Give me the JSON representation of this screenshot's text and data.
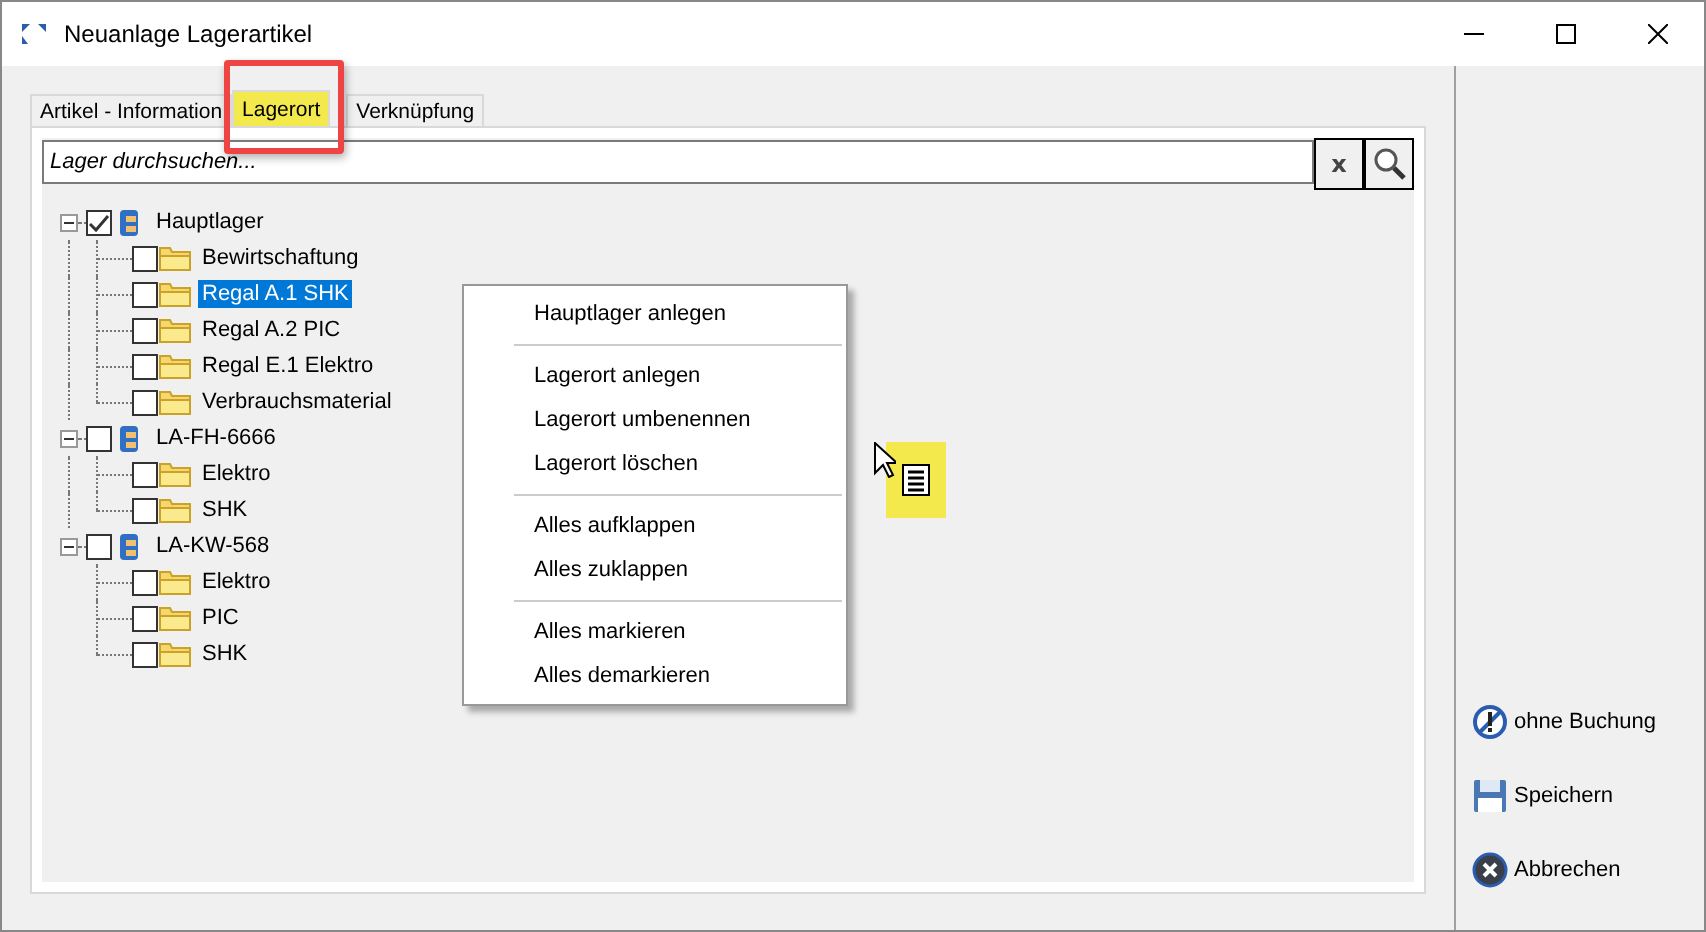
{
  "window": {
    "title": "Neuanlage Lagerartikel"
  },
  "tabs": [
    {
      "label": "Artikel - Information",
      "selected": false
    },
    {
      "label": "Lagerort",
      "selected": true,
      "highlighted": true
    },
    {
      "label": "Verknüpfung",
      "selected": false
    }
  ],
  "search": {
    "placeholder": "Lager durchsuchen...",
    "clear_label": "x"
  },
  "tree": [
    {
      "label": "Hauptlager",
      "checked": true,
      "selected": false,
      "expanded": true,
      "children": [
        {
          "label": "Bewirtschaftung",
          "checked": false,
          "selected": false
        },
        {
          "label": "Regal A.1 SHK",
          "checked": false,
          "selected": true
        },
        {
          "label": "Regal A.2 PIC",
          "checked": false,
          "selected": false
        },
        {
          "label": "Regal E.1 Elektro",
          "checked": false,
          "selected": false
        },
        {
          "label": "Verbrauchsmaterial",
          "checked": false,
          "selected": false
        }
      ]
    },
    {
      "label": "LA-FH-6666",
      "checked": false,
      "selected": false,
      "expanded": true,
      "children": [
        {
          "label": "Elektro",
          "checked": false,
          "selected": false
        },
        {
          "label": "SHK",
          "checked": false,
          "selected": false
        }
      ]
    },
    {
      "label": "LA-KW-568",
      "checked": false,
      "selected": false,
      "expanded": true,
      "children": [
        {
          "label": "Elektro",
          "checked": false,
          "selected": false
        },
        {
          "label": "PIC",
          "checked": false,
          "selected": false
        },
        {
          "label": "SHK",
          "checked": false,
          "selected": false
        }
      ]
    }
  ],
  "context_menu": [
    [
      "Hauptlager anlegen"
    ],
    [
      "Lagerort anlegen",
      "Lagerort umbenennen",
      "Lagerort löschen"
    ],
    [
      "Alles aufklappen",
      "Alles zuklappen"
    ],
    [
      "Alles markieren",
      "Alles demarkieren"
    ]
  ],
  "actions": [
    {
      "kind": "nobook",
      "label": "ohne Buchung"
    },
    {
      "kind": "save",
      "label": "Speichern"
    },
    {
      "kind": "cancel",
      "label": "Abbrechen"
    }
  ]
}
